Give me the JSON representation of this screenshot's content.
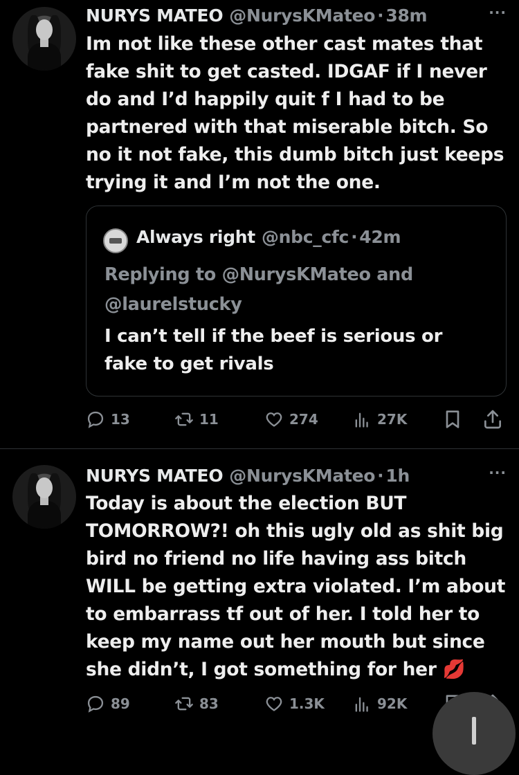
{
  "tweets": [
    {
      "author_name": "NURYS MATEO",
      "author_handle": "@NurysKMateo",
      "separator": "·",
      "time": "38m",
      "more": "···",
      "text": "Im not like these other cast mates that\nfake shit to get casted. IDGAF if I never\ndo and I’d happily quit f I had to be\npartnered with that miserable bitch. So\nno it not fake, this dumb bitch just keeps\ntrying it and I’m not the one.",
      "quote": {
        "author_name": "Always right",
        "author_handle": "@nbc_cfc",
        "separator": "·",
        "time": "42m",
        "replying_prefix": "Replying to",
        "replying_to_1": "@NurysKMateo",
        "replying_and": "and",
        "replying_to_2": "@laurelstucky",
        "text": "I can’t tell if the beef is serious or\nfake to get rivals"
      },
      "replies": "13",
      "reposts": "11",
      "likes": "274",
      "views": "27K"
    },
    {
      "author_name": "NURYS MATEO",
      "author_handle": "@NurysKMateo",
      "separator": "·",
      "time": "1h",
      "more": "···",
      "text": "Today is about the election BUT\nTOMORROW?! oh this ugly old as shit big\nbird no friend no life having ass bitch\nWILL be getting extra violated. I’m about\nto embarrass tf out of her. I told her to\nkeep my name out her mouth but since\nshe didn’t, I got something for her 💋",
      "replies": "89",
      "reposts": "83",
      "likes": "1.3K",
      "views": "92K"
    }
  ],
  "icons": {
    "reply": "reply-icon",
    "repost": "repost-icon",
    "like": "heart-icon",
    "views": "views-icon",
    "bookmark": "bookmark-icon",
    "share": "share-icon",
    "compose": "compose-icon"
  },
  "colors": {
    "background": "#000000",
    "text": "#e7e9ea",
    "muted": "#8b9096",
    "border": "#2f3336"
  }
}
